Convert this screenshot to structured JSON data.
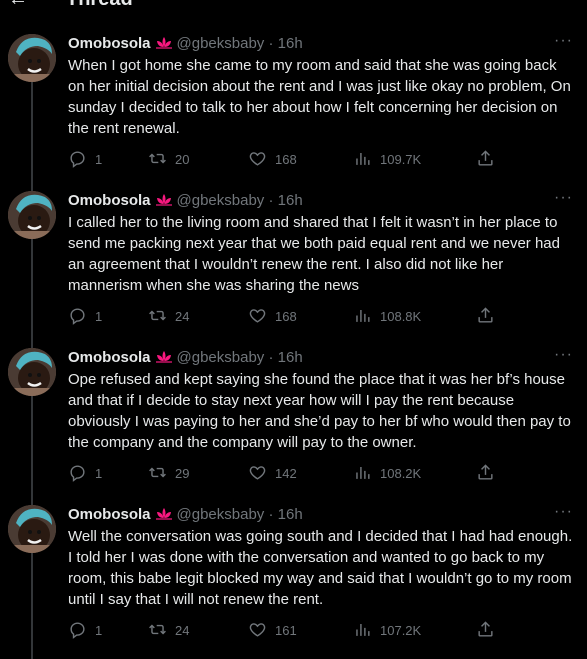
{
  "header": {
    "back_icon": "arrow-left-icon",
    "title": "Thread"
  },
  "tweets": [
    {
      "name": "Omobosola",
      "badge_icon": "lotus-icon",
      "handle": "@gbeksbaby",
      "dot": "·",
      "time": "16h",
      "more_icon": "more-icon",
      "more": "···",
      "text": "When I got home she came to my room and said that she was going back on her initial decision about the rent and I was just like okay no problem, On sunday I decided to talk to her about how I felt concerning her decision on the rent renewal.",
      "replies": "1",
      "retweets": "20",
      "likes": "168",
      "views": "109.7K"
    },
    {
      "name": "Omobosola",
      "badge_icon": "lotus-icon",
      "handle": "@gbeksbaby",
      "dot": "·",
      "time": "16h",
      "more_icon": "more-icon",
      "more": "···",
      "text": "I called her to the living room and shared that I felt it wasn’t in her place to send me packing next year that we both paid equal rent and we never had an agreement that I wouldn’t renew the rent. I also did not like her mannerism when she was sharing the news",
      "replies": "1",
      "retweets": "24",
      "likes": "168",
      "views": "108.8K"
    },
    {
      "name": "Omobosola",
      "badge_icon": "lotus-icon",
      "handle": "@gbeksbaby",
      "dot": "·",
      "time": "16h",
      "more_icon": "more-icon",
      "more": "···",
      "text": "Ope refused and kept saying she found the place that it was her bf’s house and that if I decide to stay next year how will I pay the rent because obviously I was paying to her and she’d pay to her bf who would then pay to the company and the company will pay to the owner.",
      "replies": "1",
      "retweets": "29",
      "likes": "142",
      "views": "108.2K"
    },
    {
      "name": "Omobosola",
      "badge_icon": "lotus-icon",
      "handle": "@gbeksbaby",
      "dot": "·",
      "time": "16h",
      "more_icon": "more-icon",
      "more": "···",
      "text": "Well the conversation was going south and I decided that I had had enough. I told her I was done with the conversation and wanted to go back to my room, this babe legit blocked my way and said that I wouldn’t go to my room until I say that I will not renew the rent.",
      "replies": "1",
      "retweets": "24",
      "likes": "161",
      "views": "107.2K"
    }
  ],
  "action_icons": {
    "reply": "reply-icon",
    "retweet": "retweet-icon",
    "like": "heart-icon",
    "views": "views-icon",
    "share": "share-icon"
  },
  "colors": {
    "background": "#000000",
    "text": "#e7e9ea",
    "secondary": "#71767b",
    "divider": "#2f3336",
    "lotus": "#f91880"
  }
}
